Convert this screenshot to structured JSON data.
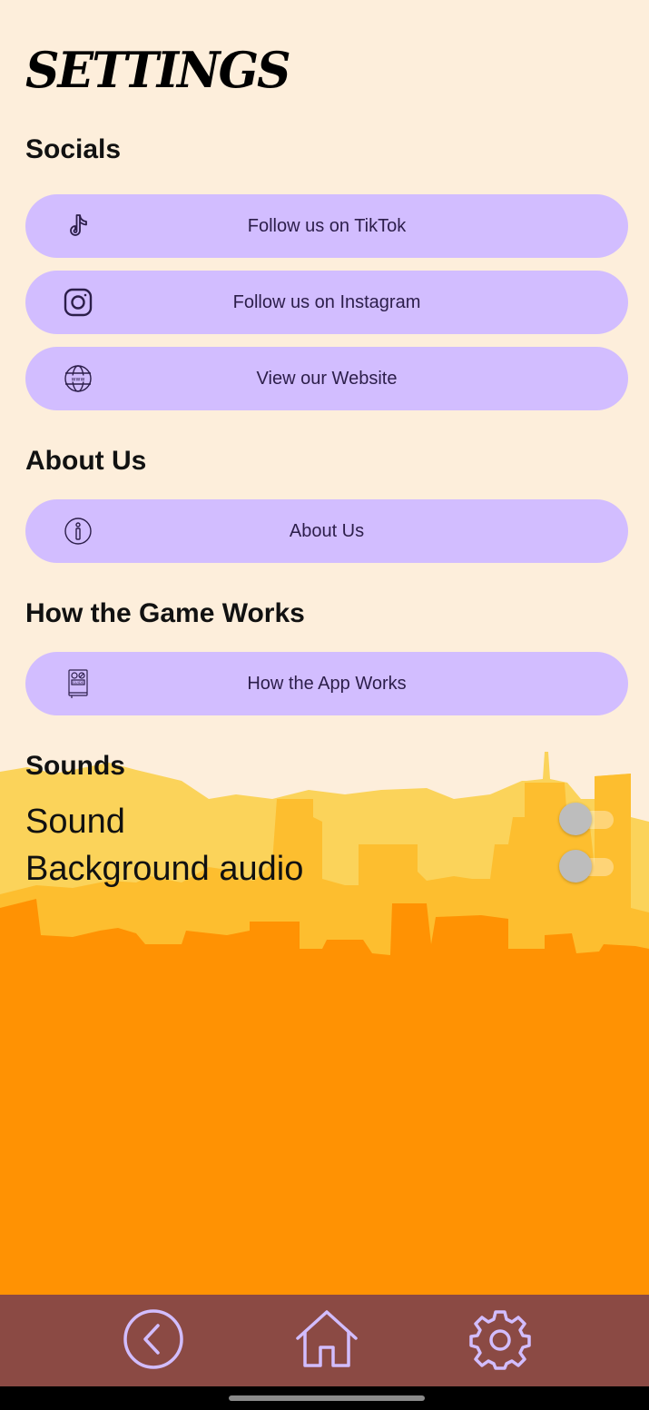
{
  "header": {
    "title": "SETTINGS"
  },
  "sections": {
    "socials": {
      "heading": "Socials",
      "items": [
        {
          "label": "Follow us on TikTok",
          "icon": "tiktok-icon"
        },
        {
          "label": "Follow us on Instagram",
          "icon": "instagram-icon"
        },
        {
          "label": "View our Website",
          "icon": "globe-icon"
        }
      ]
    },
    "about": {
      "heading": "About Us",
      "items": [
        {
          "label": "About Us",
          "icon": "info-icon"
        }
      ]
    },
    "how": {
      "heading": "How the Game Works",
      "items": [
        {
          "label": "How the App Works",
          "icon": "guide-book-icon"
        }
      ]
    },
    "sounds": {
      "heading": "Sounds",
      "toggles": [
        {
          "label": "Sound",
          "state": "off"
        },
        {
          "label": "Background audio",
          "state": "off"
        }
      ]
    }
  },
  "bottom_nav": {
    "items": [
      {
        "name": "back",
        "icon": "back-arrow-icon"
      },
      {
        "name": "home",
        "icon": "home-icon"
      },
      {
        "name": "settings",
        "icon": "gear-icon"
      }
    ]
  },
  "colors": {
    "background": "#fdeedb",
    "pill": "#d2bdff",
    "pill_text": "#2c1e4a",
    "nav_bar": "#8b4a44",
    "nav_icon": "#d2bdff",
    "skyline_light": "#fbd35a",
    "skyline_mid": "#fdbe2f",
    "skyline_dark": "#ff9203"
  }
}
